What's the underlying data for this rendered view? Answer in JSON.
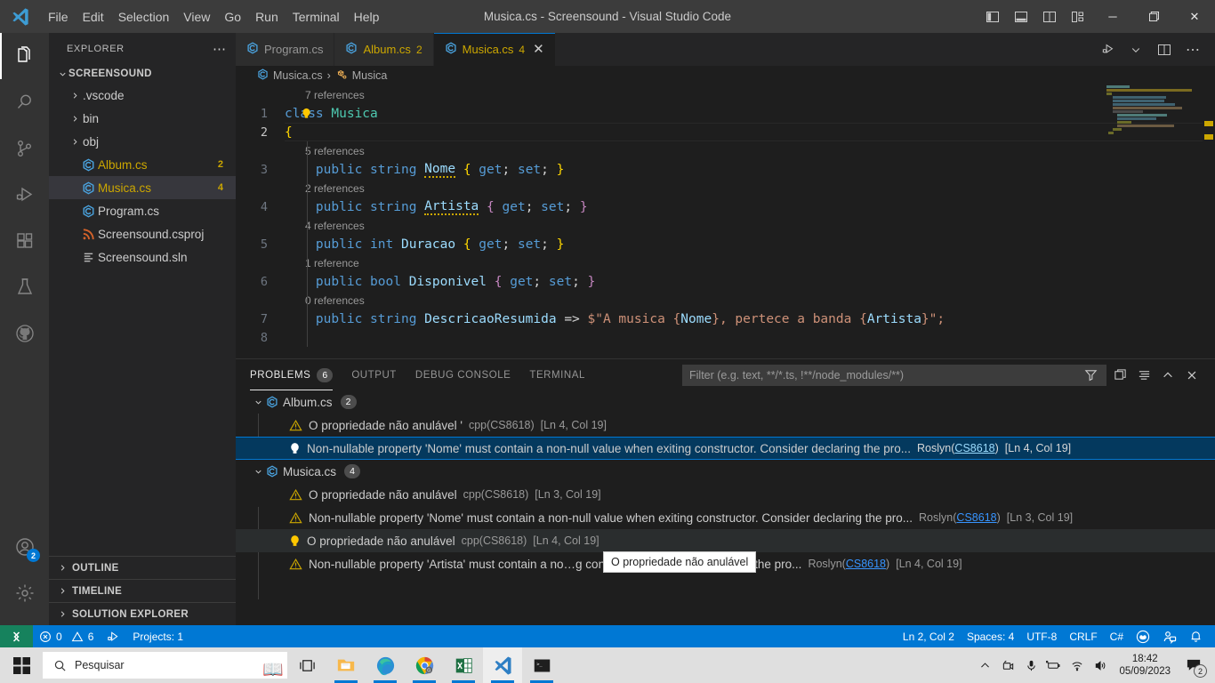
{
  "titlebar": {
    "logo_icon": "vscode-logo-icon",
    "menus": [
      "File",
      "Edit",
      "Selection",
      "View",
      "Go",
      "Run",
      "Terminal",
      "Help"
    ],
    "title": "Musica.cs - Screensound - Visual Studio Code",
    "layout_buttons": [
      "toggle-primary-sidebar-icon",
      "toggle-panel-icon",
      "toggle-secondary-sidebar-icon",
      "customize-layout-icon"
    ],
    "window_controls": {
      "minimize": "─",
      "maximize": "❐",
      "close": "✕"
    }
  },
  "activitybar": {
    "items": [
      {
        "name": "explorer",
        "icon": "files-icon",
        "active": true
      },
      {
        "name": "search",
        "icon": "search-icon",
        "active": false
      },
      {
        "name": "source-control",
        "icon": "source-control-icon",
        "active": false
      },
      {
        "name": "run-and-debug",
        "icon": "run-debug-icon",
        "active": false
      },
      {
        "name": "extensions",
        "icon": "extensions-icon",
        "active": false
      },
      {
        "name": "testing",
        "icon": "beaker-icon",
        "active": false
      },
      {
        "name": "github",
        "icon": "github-icon",
        "active": false
      }
    ],
    "accounts": {
      "icon": "account-icon",
      "badge": "2"
    },
    "settings": {
      "icon": "gear-icon"
    }
  },
  "sidebar": {
    "header": {
      "title": "EXPLORER",
      "more_icon": "ellipsis-icon"
    },
    "root": {
      "label": "SCREENSOUND",
      "expanded": true
    },
    "files": [
      {
        "label": ".vscode",
        "type": "folder",
        "icon": "chevron-right-icon",
        "badge": ""
      },
      {
        "label": "bin",
        "type": "folder",
        "icon": "chevron-right-icon",
        "badge": ""
      },
      {
        "label": "obj",
        "type": "folder",
        "icon": "chevron-right-icon",
        "badge": ""
      },
      {
        "label": "Album.cs",
        "type": "csharp",
        "icon": "csharp-icon",
        "badge": "2",
        "warn": true
      },
      {
        "label": "Musica.cs",
        "type": "csharp",
        "icon": "csharp-icon",
        "badge": "4",
        "warn": true,
        "selected": true
      },
      {
        "label": "Program.cs",
        "type": "csharp",
        "icon": "csharp-icon",
        "badge": ""
      },
      {
        "label": "Screensound.csproj",
        "type": "csproj",
        "icon": "csproj-icon",
        "badge": ""
      },
      {
        "label": "Screensound.sln",
        "type": "sln",
        "icon": "sln-icon",
        "badge": ""
      }
    ],
    "sections": [
      "OUTLINE",
      "TIMELINE",
      "SOLUTION EXPLORER"
    ]
  },
  "editor": {
    "tabs": [
      {
        "label": "Program.cs",
        "count": "",
        "active": false,
        "icon": "csharp-icon"
      },
      {
        "label": "Album.cs",
        "count": "2",
        "active": false,
        "icon": "csharp-icon"
      },
      {
        "label": "Musica.cs",
        "count": "4",
        "active": true,
        "icon": "csharp-icon",
        "close_icon": "close-icon"
      }
    ],
    "actions": [
      "run-or-debug-icon",
      "chevron-down-icon",
      "split-editor-icon",
      "more-actions-icon"
    ],
    "breadcrumb": {
      "file": "Musica.cs",
      "separator": "›",
      "symbol": "Musica",
      "file_icon": "csharp-icon",
      "class_icon": "class-symbol-icon"
    },
    "lines": [
      {
        "num": "1",
        "reference_hint": "7 references",
        "has_bulb": true,
        "current": false,
        "tokens": [
          {
            "t": "class",
            "c": "k"
          },
          {
            "t": " ",
            "c": "op"
          },
          {
            "t": "Musica",
            "c": "ty"
          }
        ]
      },
      {
        "num": "2",
        "reference_hint": "",
        "current": true,
        "tokens": [
          {
            "t": "{",
            "c": "pl"
          }
        ]
      },
      {
        "num": "3",
        "reference_hint": "5 references",
        "indent": true,
        "tokens": [
          {
            "t": "    public",
            "c": "k"
          },
          {
            "t": " ",
            "c": "op"
          },
          {
            "t": "string",
            "c": "k"
          },
          {
            "t": " ",
            "c": "op"
          },
          {
            "t": "Nome",
            "c": "id squig"
          },
          {
            "t": " ",
            "c": "op"
          },
          {
            "t": "{",
            "c": "pl"
          },
          {
            "t": " ",
            "c": "op"
          },
          {
            "t": "get",
            "c": "k"
          },
          {
            "t": "; ",
            "c": "op"
          },
          {
            "t": "set",
            "c": "k"
          },
          {
            "t": "; ",
            "c": "op"
          },
          {
            "t": "}",
            "c": "pl"
          }
        ]
      },
      {
        "num": "4",
        "reference_hint": "2 references",
        "indent": true,
        "tokens": [
          {
            "t": "    public",
            "c": "k"
          },
          {
            "t": " ",
            "c": "op"
          },
          {
            "t": "string",
            "c": "k"
          },
          {
            "t": " ",
            "c": "op"
          },
          {
            "t": "Artista",
            "c": "id squig"
          },
          {
            "t": " ",
            "c": "op"
          },
          {
            "t": "{",
            "c": "kk"
          },
          {
            "t": " ",
            "c": "op"
          },
          {
            "t": "get",
            "c": "k"
          },
          {
            "t": "; ",
            "c": "op"
          },
          {
            "t": "set",
            "c": "k"
          },
          {
            "t": "; ",
            "c": "op"
          },
          {
            "t": "}",
            "c": "kk"
          }
        ]
      },
      {
        "num": "5",
        "reference_hint": "4 references",
        "indent": true,
        "tokens": [
          {
            "t": "    public",
            "c": "k"
          },
          {
            "t": " ",
            "c": "op"
          },
          {
            "t": "int",
            "c": "k"
          },
          {
            "t": " ",
            "c": "op"
          },
          {
            "t": "Duracao",
            "c": "id"
          },
          {
            "t": " ",
            "c": "op"
          },
          {
            "t": "{",
            "c": "pl"
          },
          {
            "t": " ",
            "c": "op"
          },
          {
            "t": "get",
            "c": "k"
          },
          {
            "t": "; ",
            "c": "op"
          },
          {
            "t": "set",
            "c": "k"
          },
          {
            "t": "; ",
            "c": "op"
          },
          {
            "t": "}",
            "c": "pl"
          }
        ]
      },
      {
        "num": "6",
        "reference_hint": "1 reference",
        "indent": true,
        "tokens": [
          {
            "t": "    public",
            "c": "k"
          },
          {
            "t": " ",
            "c": "op"
          },
          {
            "t": "bool",
            "c": "k"
          },
          {
            "t": " ",
            "c": "op"
          },
          {
            "t": "Disponivel",
            "c": "id"
          },
          {
            "t": " ",
            "c": "op"
          },
          {
            "t": "{",
            "c": "kk"
          },
          {
            "t": " ",
            "c": "op"
          },
          {
            "t": "get",
            "c": "k"
          },
          {
            "t": "; ",
            "c": "op"
          },
          {
            "t": "set",
            "c": "k"
          },
          {
            "t": "; ",
            "c": "op"
          },
          {
            "t": "}",
            "c": "kk"
          }
        ]
      },
      {
        "num": "7",
        "reference_hint": "0 references",
        "indent": true,
        "tokens": [
          {
            "t": "    public",
            "c": "k"
          },
          {
            "t": " ",
            "c": "op"
          },
          {
            "t": "string",
            "c": "k"
          },
          {
            "t": " ",
            "c": "op"
          },
          {
            "t": "DescricaoResumida",
            "c": "id"
          },
          {
            "t": " ",
            "c": "op"
          },
          {
            "t": "=>",
            "c": "op"
          },
          {
            "t": " ",
            "c": "op"
          },
          {
            "t": "$\"A musica ",
            "c": "st"
          },
          {
            "t": "{",
            "c": "st"
          },
          {
            "t": "Nome",
            "c": "id"
          },
          {
            "t": "}",
            "c": "st"
          },
          {
            "t": ", pertece a banda ",
            "c": "st"
          },
          {
            "t": "{",
            "c": "st"
          },
          {
            "t": "Artista",
            "c": "id"
          },
          {
            "t": "}",
            "c": "st"
          },
          {
            "t": "\";",
            "c": "st"
          }
        ]
      },
      {
        "num": "8",
        "reference_hint": "",
        "indent": true,
        "tokens": []
      }
    ]
  },
  "panel": {
    "tabs": [
      {
        "label": "PROBLEMS",
        "badge": "6",
        "active": true
      },
      {
        "label": "OUTPUT",
        "badge": "",
        "active": false
      },
      {
        "label": "DEBUG CONSOLE",
        "badge": "",
        "active": false
      },
      {
        "label": "TERMINAL",
        "badge": "",
        "active": false
      }
    ],
    "filter": {
      "placeholder": "Filter (e.g. text, **/*.ts, !**/node_modules/**)",
      "value": ""
    },
    "actions": [
      "filter-icon",
      "view-as-table-icon",
      "collapse-all-icon",
      "maximize-panel-icon",
      "close-panel-icon"
    ],
    "groups": [
      {
        "file": "Album.cs",
        "badge": "2",
        "icon": "csharp-icon",
        "expanded": true,
        "items": [
          {
            "severity": "warning",
            "icon": "warning-icon",
            "message": "O propriedade não anulável '",
            "source": "cpp(CS8618)",
            "location": "[Ln 4, Col 19]",
            "selected": false
          },
          {
            "severity": "hint",
            "icon": "lightbulb-icon",
            "message": "Non-nullable property 'Nome' must contain a non-null value when exiting constructor. Consider declaring the pro...",
            "source": "Roslyn",
            "code": "CS8618",
            "location": "[Ln 4, Col 19]",
            "selected": true
          }
        ]
      },
      {
        "file": "Musica.cs",
        "badge": "4",
        "icon": "csharp-icon",
        "expanded": true,
        "items": [
          {
            "severity": "warning",
            "icon": "warning-icon",
            "message": "O propriedade não anulável",
            "source": "cpp(CS8618)",
            "location": "[Ln 3, Col 19]",
            "selected": false
          },
          {
            "severity": "warning",
            "icon": "warning-icon",
            "message": "Non-nullable property 'Nome' must contain a non-null value when exiting constructor. Consider declaring the pro...",
            "source": "Roslyn",
            "code": "CS8618",
            "location": "[Ln 3, Col 19]",
            "selected": false
          },
          {
            "severity": "hint",
            "icon": "lightbulb-icon",
            "message": "O propriedade não anulável",
            "source": "cpp(CS8618)",
            "location": "[Ln 4, Col 19]",
            "selected": false,
            "hovered": true
          },
          {
            "severity": "warning",
            "icon": "warning-icon",
            "message": "Non-nullable property 'Artista' must contain a no…g constructor. Consider declaring the pro...",
            "source": "Roslyn",
            "code": "CS8618",
            "location": "[Ln 4, Col 19]",
            "selected": false
          }
        ]
      }
    ],
    "tooltip": "O propriedade não anulável"
  },
  "statusbar": {
    "remote_icon": "remote-window-icon",
    "errors": "0",
    "warnings": "6",
    "error_icon": "error-circle-icon",
    "warning_icon": "warning-triangle-icon",
    "debug_icon": "run-debug-icon",
    "projects": "Projects: 1",
    "cursor": "Ln 2, Col 2",
    "indentation": "Spaces: 4",
    "encoding": "UTF-8",
    "eol": "CRLF",
    "language": "C#",
    "copilot_icon": "copilot-icon",
    "feedback_icon": "feedback-person-icon",
    "bell_icon": "bell-icon"
  },
  "taskbar": {
    "start_icon": "windows-start-icon",
    "search": {
      "placeholder": "Pesquisar",
      "icon": "search-icon"
    },
    "task_view_icon": "task-view-icon",
    "apps": [
      {
        "name": "file-explorer",
        "icon": "folder-icon",
        "running": true
      },
      {
        "name": "microsoft-edge",
        "icon": "edge-icon",
        "running": true
      },
      {
        "name": "google-chrome",
        "icon": "chrome-icon",
        "running": true
      },
      {
        "name": "excel",
        "icon": "excel-icon",
        "running": true
      },
      {
        "name": "visual-studio-code",
        "icon": "vscode-icon",
        "running": true,
        "active": true
      },
      {
        "name": "terminal",
        "icon": "terminal-icon",
        "running": true
      }
    ],
    "tray": {
      "chevron_icon": "chevron-up-icon",
      "icons": [
        "camera-icon",
        "microphone-icon",
        "battery-icon",
        "wifi-icon",
        "speaker-icon"
      ],
      "time": "18:42",
      "date": "05/09/2023",
      "notification_icon": "notification-icon",
      "notification_count": "2"
    }
  }
}
